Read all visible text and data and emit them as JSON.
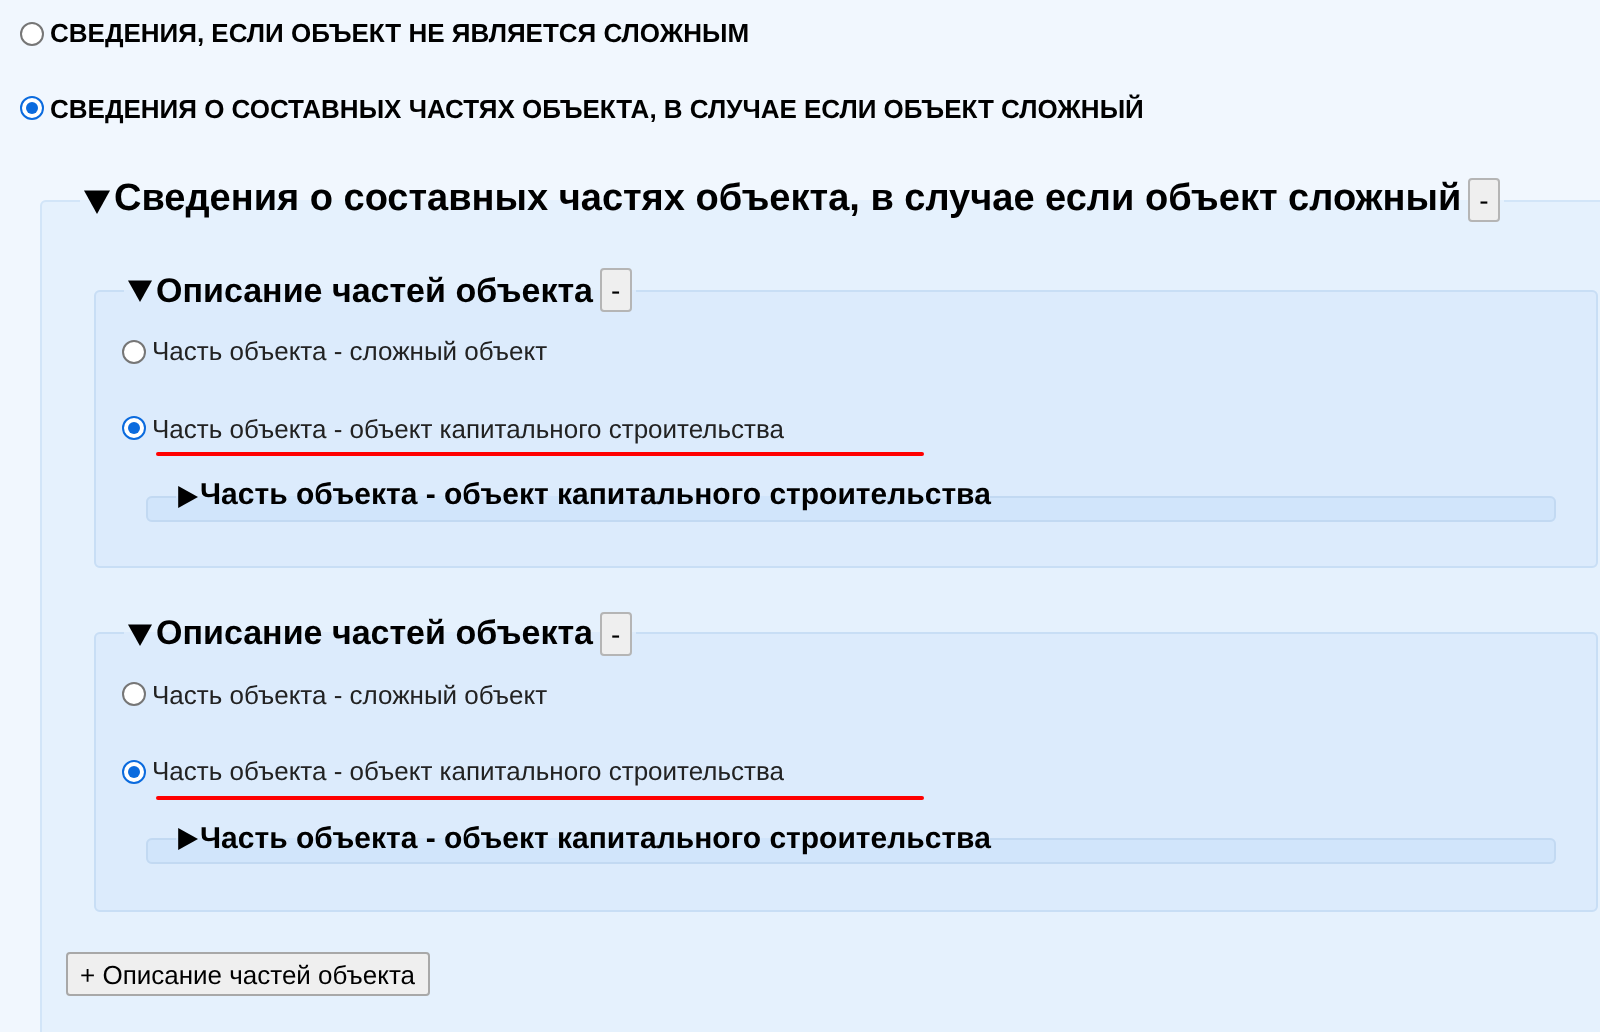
{
  "options": [
    {
      "label": "СВЕДЕНИЯ, ЕСЛИ ОБЪЕКТ НЕ ЯВЛЯЕТСЯ СЛОЖНЫМ",
      "selected": false
    },
    {
      "label": "СВЕДЕНИЯ О СОСТАВНЫХ ЧАСТЯХ ОБЪЕКТА, В СЛУЧАЕ ЕСЛИ ОБЪЕКТ СЛОЖНЫЙ",
      "selected": true
    }
  ],
  "section": {
    "title": "Сведения о составных частях объекта, в случае если объект сложный",
    "expanded": true,
    "remove_label": "-",
    "parts": [
      {
        "title": "Описание частей объекта",
        "expanded": true,
        "remove_label": "-",
        "options": [
          {
            "label": "Часть объекта - сложный объект",
            "selected": false,
            "underlined": false
          },
          {
            "label": "Часть объекта - объект капитального строительства",
            "selected": true,
            "underlined": true
          }
        ],
        "subsection": {
          "title": "Часть объекта - объект капитального строительства",
          "expanded": false
        }
      },
      {
        "title": "Описание частей объекта",
        "expanded": true,
        "remove_label": "-",
        "options": [
          {
            "label": "Часть объекта - сложный объект",
            "selected": false,
            "underlined": false
          },
          {
            "label": "Часть объекта - объект капитального строительства",
            "selected": true,
            "underlined": true
          }
        ],
        "subsection": {
          "title": "Часть объекта - объект капитального строительства",
          "expanded": false
        }
      }
    ],
    "add_label": "+ Описание частей объекта"
  }
}
